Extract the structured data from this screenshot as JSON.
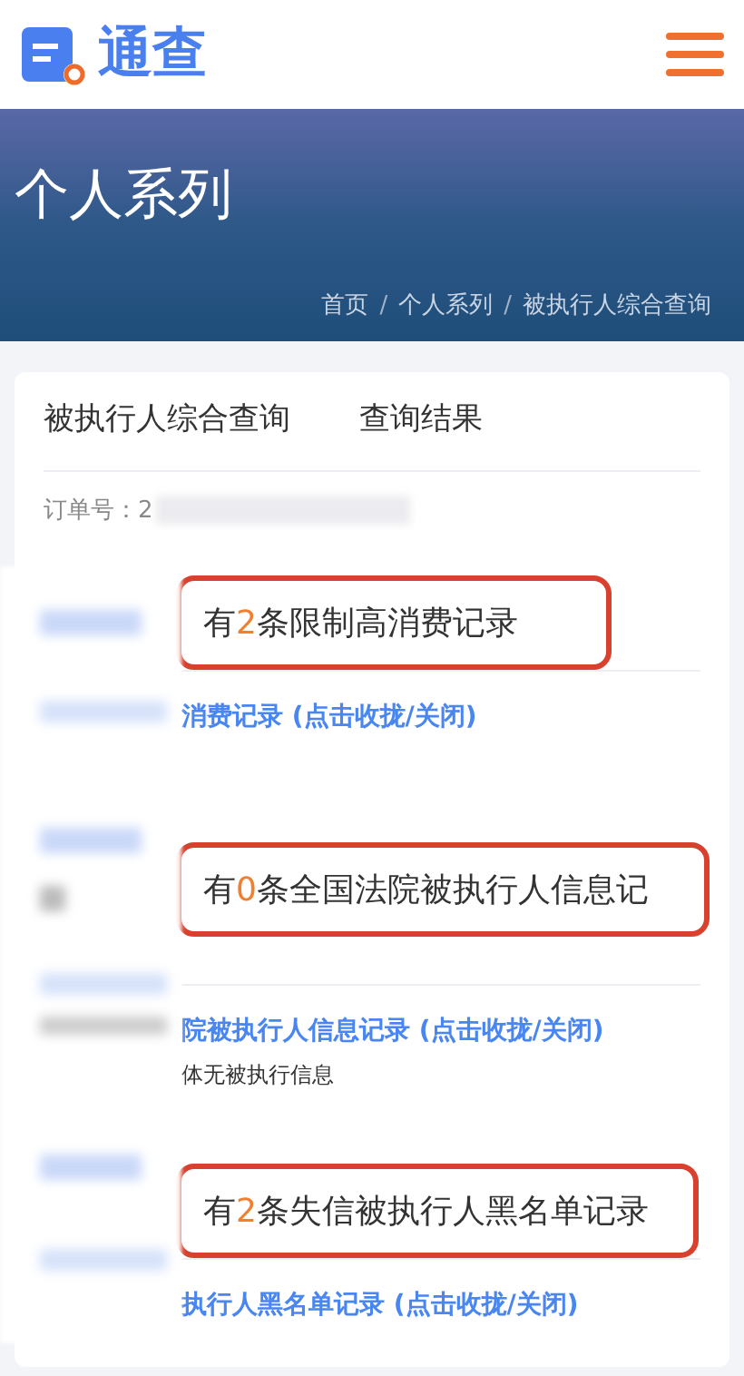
{
  "header": {
    "logo_text": "通查"
  },
  "banner": {
    "title": "个人系列",
    "breadcrumb": [
      {
        "label": "首页",
        "separator": "/"
      },
      {
        "label": "个人系列",
        "separator": "/"
      },
      {
        "label": "被执行人综合查询"
      }
    ]
  },
  "card": {
    "tabs": [
      "被执行人综合查询",
      "查询结果"
    ],
    "order_label": "订单号：2",
    "sections": [
      {
        "prefix": "有",
        "count": "2",
        "suffix": "条限制高消费记录",
        "link": "消费记录 (点击收拢/关闭)"
      },
      {
        "prefix": "有",
        "count": "0",
        "suffix": "条全国法院被执行人信息记",
        "link": "院被执行人信息记录 (点击收拢/关闭)",
        "note": "体无被执行信息"
      },
      {
        "prefix": "有",
        "count": "2",
        "suffix": "条失信被执行人黑名单记录",
        "link": "执行人黑名单记录 (点击收拢/关闭)"
      }
    ]
  }
}
